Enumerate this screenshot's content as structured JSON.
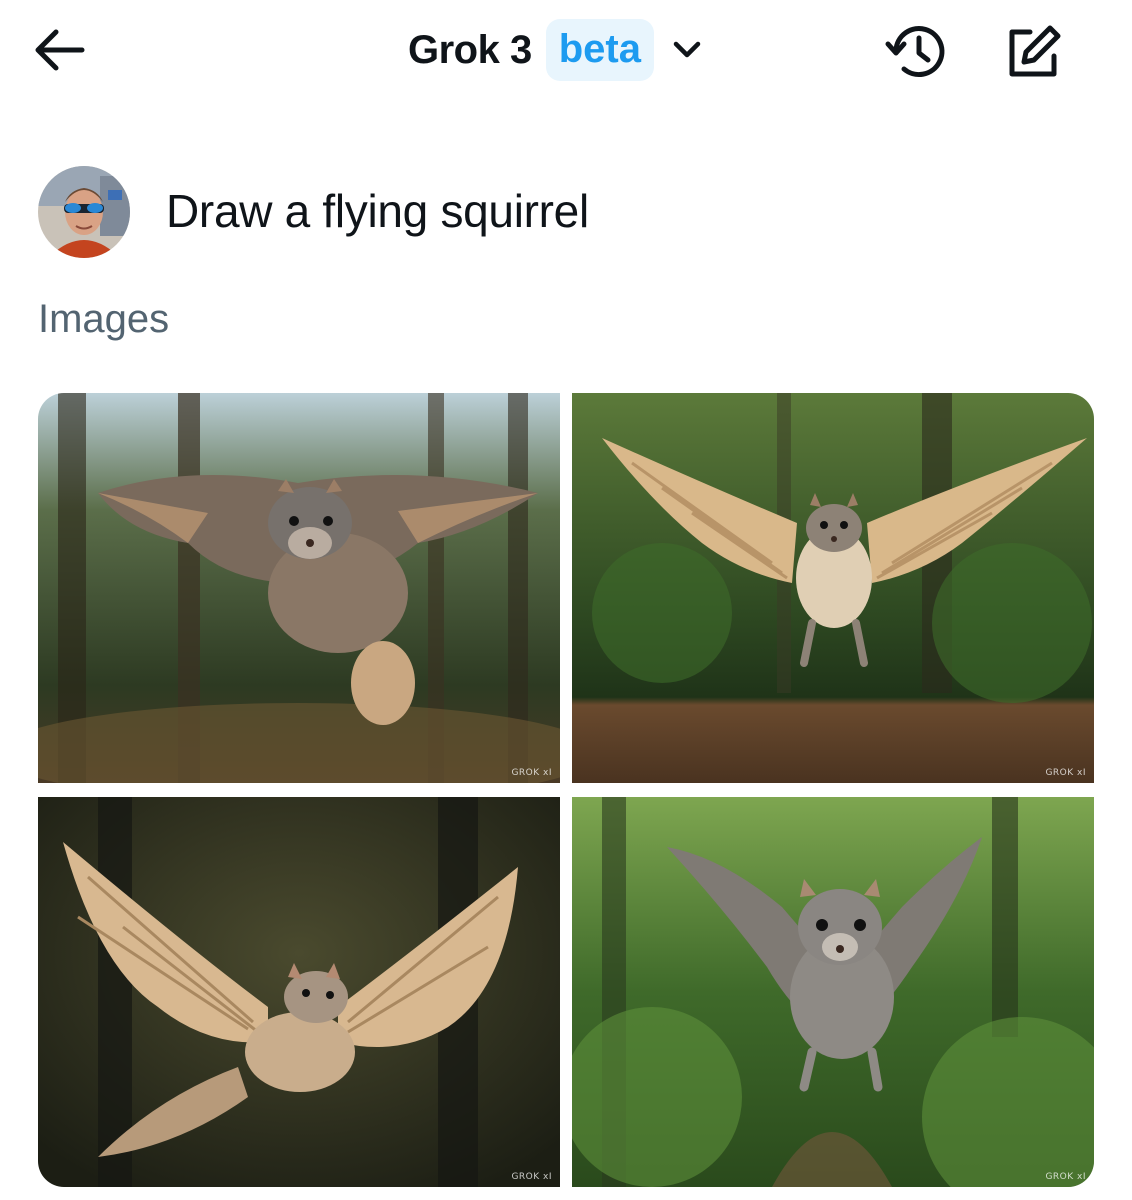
{
  "header": {
    "model_name": "Grok 3",
    "badge": "beta",
    "icons": {
      "back": "arrow-left-icon",
      "dropdown": "chevron-down-icon",
      "history": "history-icon",
      "compose": "compose-icon"
    }
  },
  "conversation": {
    "prompt": "Draw a flying squirrel",
    "section_label": "Images"
  },
  "images": [
    {
      "watermark": "GROK ⅹI"
    },
    {
      "watermark": "GROK ⅹI"
    },
    {
      "watermark": "GROK ⅹI"
    },
    {
      "watermark": "GROK ⅹI"
    }
  ],
  "colors": {
    "text": "#0f1419",
    "secondary_text": "#536471",
    "accent": "#1d9bf0",
    "badge_bg": "#e8f5fd"
  }
}
